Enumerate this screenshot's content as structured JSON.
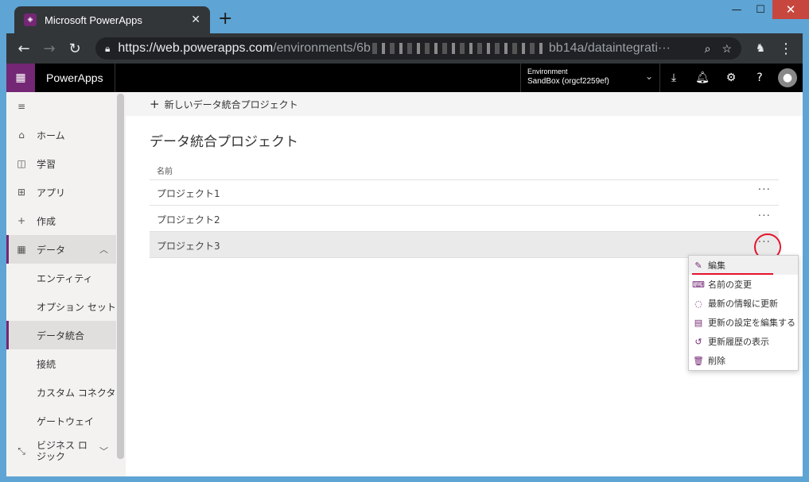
{
  "browser": {
    "tab_title": "Microsoft PowerApps",
    "tab_close": "✕",
    "new_tab": "+",
    "url_host": "https://web.powerapps.com",
    "url_path_start": "/environments/6b",
    "url_path_end": "bb14a/dataintegrati···",
    "window_controls": {
      "minimize": "—",
      "maximize": "☐",
      "close": "✕"
    }
  },
  "appbar": {
    "brand": "PowerApps",
    "environment_label": "Environment",
    "environment_value": "SandBox (orgcf2259ef)"
  },
  "sidebar": {
    "items": [
      {
        "label": "ホーム",
        "icon": "home-icon"
      },
      {
        "label": "学習",
        "icon": "book-icon"
      },
      {
        "label": "アプリ",
        "icon": "apps-icon"
      },
      {
        "label": "作成",
        "icon": "plus-icon"
      },
      {
        "label": "データ",
        "icon": "table-icon"
      },
      {
        "label": "エンティティ"
      },
      {
        "label": "オプション セット"
      },
      {
        "label": "データ統合"
      },
      {
        "label": "接続"
      },
      {
        "label": "カスタム コネクタ"
      },
      {
        "label": "ゲートウェイ"
      },
      {
        "label": "ビジネス ロ\nジック",
        "icon": "flow-icon"
      }
    ]
  },
  "main": {
    "new_project": "新しいデータ統合プロジェクト",
    "title": "データ統合プロジェクト",
    "column_name": "名前",
    "rows": [
      "プロジェクト1",
      "プロジェクト2",
      "プロジェクト3"
    ],
    "more": "···"
  },
  "context_menu": {
    "items": [
      "編集",
      "名前の変更",
      "最新の情報に更新",
      "更新の設定を編集する",
      "更新履歴の表示",
      "削除"
    ]
  },
  "colors": {
    "accent": "#742774",
    "annotation": "#e3142c"
  }
}
